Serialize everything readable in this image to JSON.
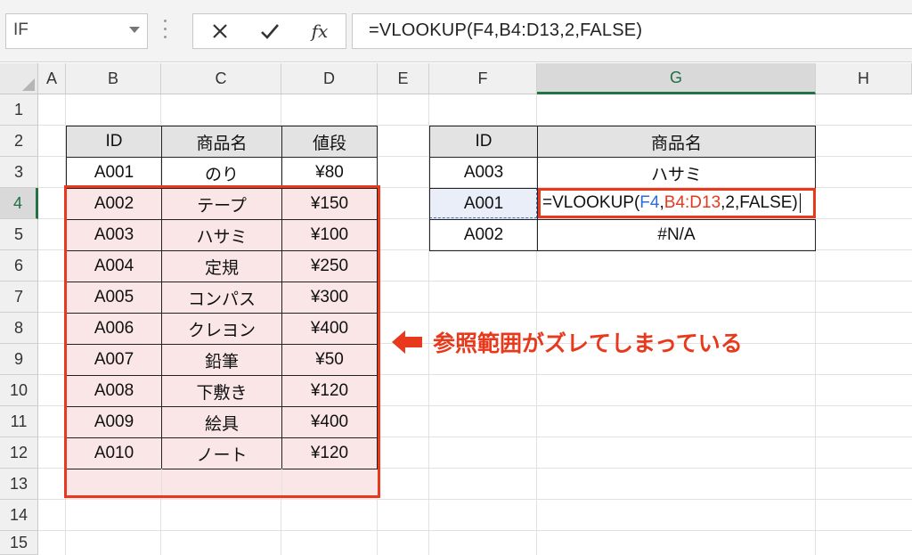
{
  "formula_bar": {
    "name_box": "IF",
    "cancel_icon": "✕",
    "enter_icon": "✔",
    "fx_label": "fx",
    "formula": "=VLOOKUP(F4,B4:D13,2,FALSE)"
  },
  "columns": [
    "A",
    "B",
    "C",
    "D",
    "E",
    "F",
    "G",
    "H"
  ],
  "rows": [
    "1",
    "2",
    "3",
    "4",
    "5",
    "6",
    "7",
    "8",
    "9",
    "10",
    "11",
    "12",
    "13",
    "14",
    "15"
  ],
  "active_col": "G",
  "active_row": "4",
  "product_table": {
    "headers": [
      "ID",
      "商品名",
      "値段"
    ],
    "rows": [
      [
        "A001",
        "のり",
        "¥80"
      ],
      [
        "A002",
        "テープ",
        "¥150"
      ],
      [
        "A003",
        "ハサミ",
        "¥100"
      ],
      [
        "A004",
        "定規",
        "¥250"
      ],
      [
        "A005",
        "コンパス",
        "¥300"
      ],
      [
        "A006",
        "クレヨン",
        "¥400"
      ],
      [
        "A007",
        "鉛筆",
        "¥50"
      ],
      [
        "A008",
        "下敷き",
        "¥120"
      ],
      [
        "A009",
        "絵具",
        "¥400"
      ],
      [
        "A010",
        "ノート",
        "¥120"
      ]
    ]
  },
  "lookup_table": {
    "headers": [
      "ID",
      "商品名"
    ],
    "rows": [
      [
        "A003",
        "ハサミ"
      ],
      [
        "A001",
        ""
      ],
      [
        "A002",
        "#N/A"
      ]
    ],
    "editing_formula_parts": [
      "=VLOOKUP(",
      "F4",
      ",",
      "B4:D13",
      ",2,FALSE)"
    ]
  },
  "annotation": {
    "text": "参照範囲がズレてしまっている",
    "color": "#e8391c"
  },
  "colors": {
    "highlight_red": "#e8391c",
    "range_fill": "#fae6e6",
    "ref_blue": "#2e6fd1",
    "excel_green": "#217346"
  }
}
